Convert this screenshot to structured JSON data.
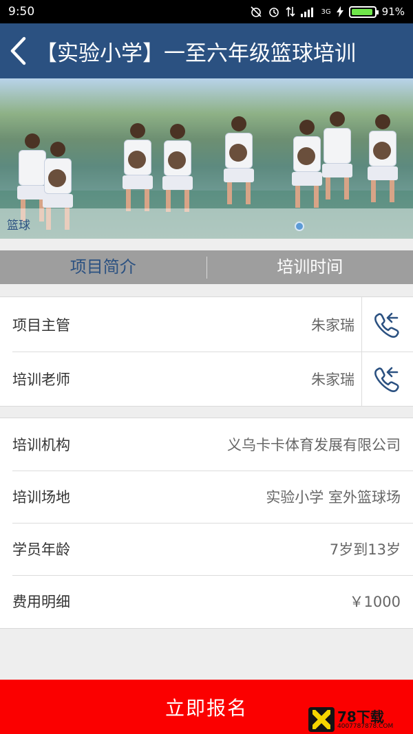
{
  "status_bar": {
    "time": "9:50",
    "network": "3G",
    "battery": "91%"
  },
  "app_bar": {
    "title": "【实验小学】一至六年级篮球培训"
  },
  "banner": {
    "caption": "篮球"
  },
  "tabs": [
    {
      "label": "项目简介"
    },
    {
      "label": "培训时间"
    }
  ],
  "contacts": [
    {
      "label": "项目主管",
      "value": "朱家瑞"
    },
    {
      "label": "培训老师",
      "value": "朱家瑞"
    }
  ],
  "details": [
    {
      "label": "培训机构",
      "value": "义乌卡卡体育发展有限公司"
    },
    {
      "label": "培训场地",
      "value": "实验小学 室外篮球场"
    },
    {
      "label": "学员年龄",
      "value": "7岁到13岁"
    },
    {
      "label": "费用明细",
      "value": "￥1000"
    }
  ],
  "cta": {
    "label": "立即报名"
  },
  "watermark": {
    "title": "78下载",
    "url": "4007787878.COM"
  },
  "colors": {
    "app_bar": "#2b5181",
    "cta": "#fb0000",
    "tab_bar": "#9e9e9e"
  }
}
